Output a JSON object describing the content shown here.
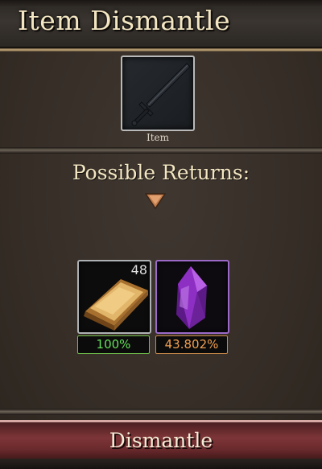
{
  "header": {
    "title": "Item Dismantle"
  },
  "item": {
    "label": "Item",
    "icon": "sword-icon"
  },
  "returns": {
    "title": "Possible Returns:",
    "items": [
      {
        "icon": "gold-ingot-icon",
        "count": "48",
        "chance": "100%",
        "chance_color": "#64e05a",
        "border_color": "#aeb1b3"
      },
      {
        "icon": "purple-crystal-icon",
        "chance": "43.802%",
        "chance_color": "#f0a050",
        "border_color": "#9b6ac9"
      }
    ]
  },
  "button": {
    "label": "Dismantle"
  }
}
